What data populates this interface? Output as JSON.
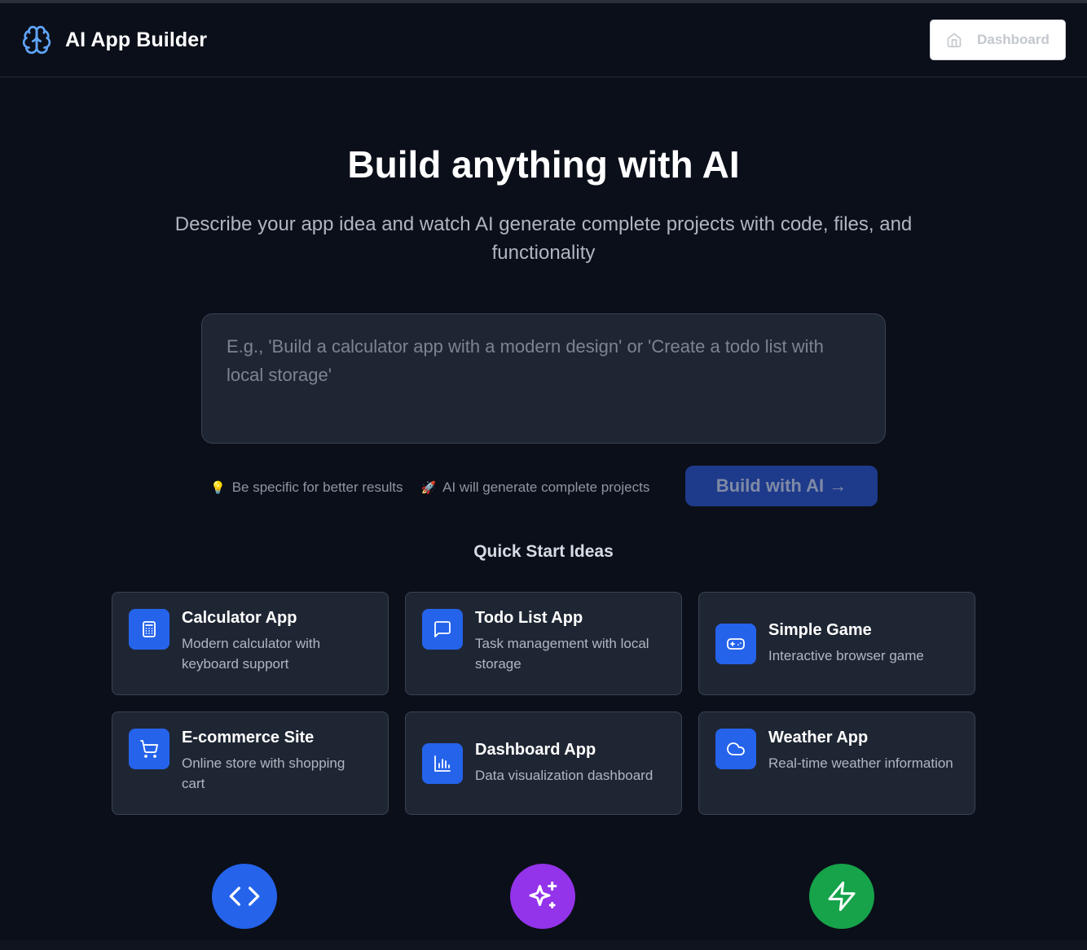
{
  "header": {
    "title": "AI App Builder",
    "dashboard_label": "Dashboard"
  },
  "hero": {
    "title": "Build anything with AI",
    "subtitle": "Describe your app idea and watch AI generate complete projects with code, files, and functionality"
  },
  "prompt": {
    "value": "",
    "placeholder": "E.g., 'Build a calculator app with a modern design' or 'Create a todo list with local storage'"
  },
  "hints": {
    "tip1_emoji": "💡",
    "tip1": "Be specific for better results",
    "tip2_emoji": "🚀",
    "tip2": "AI will generate complete projects"
  },
  "build_button": "Build with AI →",
  "quick_start": {
    "title": "Quick Start Ideas",
    "cards": [
      {
        "title": "Calculator App",
        "desc": "Modern calculator with keyboard support",
        "icon": "calculator-icon"
      },
      {
        "title": "Todo List App",
        "desc": "Task management with local storage",
        "icon": "message-square-icon"
      },
      {
        "title": "Simple Game",
        "desc": "Interactive browser game",
        "icon": "gamepad-icon"
      },
      {
        "title": "E-commerce Site",
        "desc": "Online store with shopping cart",
        "icon": "shopping-cart-icon"
      },
      {
        "title": "Dashboard App",
        "desc": "Data visualization dashboard",
        "icon": "bar-chart-icon"
      },
      {
        "title": "Weather App",
        "desc": "Real-time weather information",
        "icon": "cloud-icon"
      }
    ]
  },
  "feature_icons": [
    {
      "icon": "code-icon",
      "color": "#2563eb"
    },
    {
      "icon": "sparkles-icon",
      "color": "#9333ea"
    },
    {
      "icon": "zap-icon",
      "color": "#16a34a"
    }
  ],
  "colors": {
    "background": "#0b0f19",
    "card": "#1f2633",
    "accent": "#2563eb",
    "build_button": "#1e3a8a"
  }
}
